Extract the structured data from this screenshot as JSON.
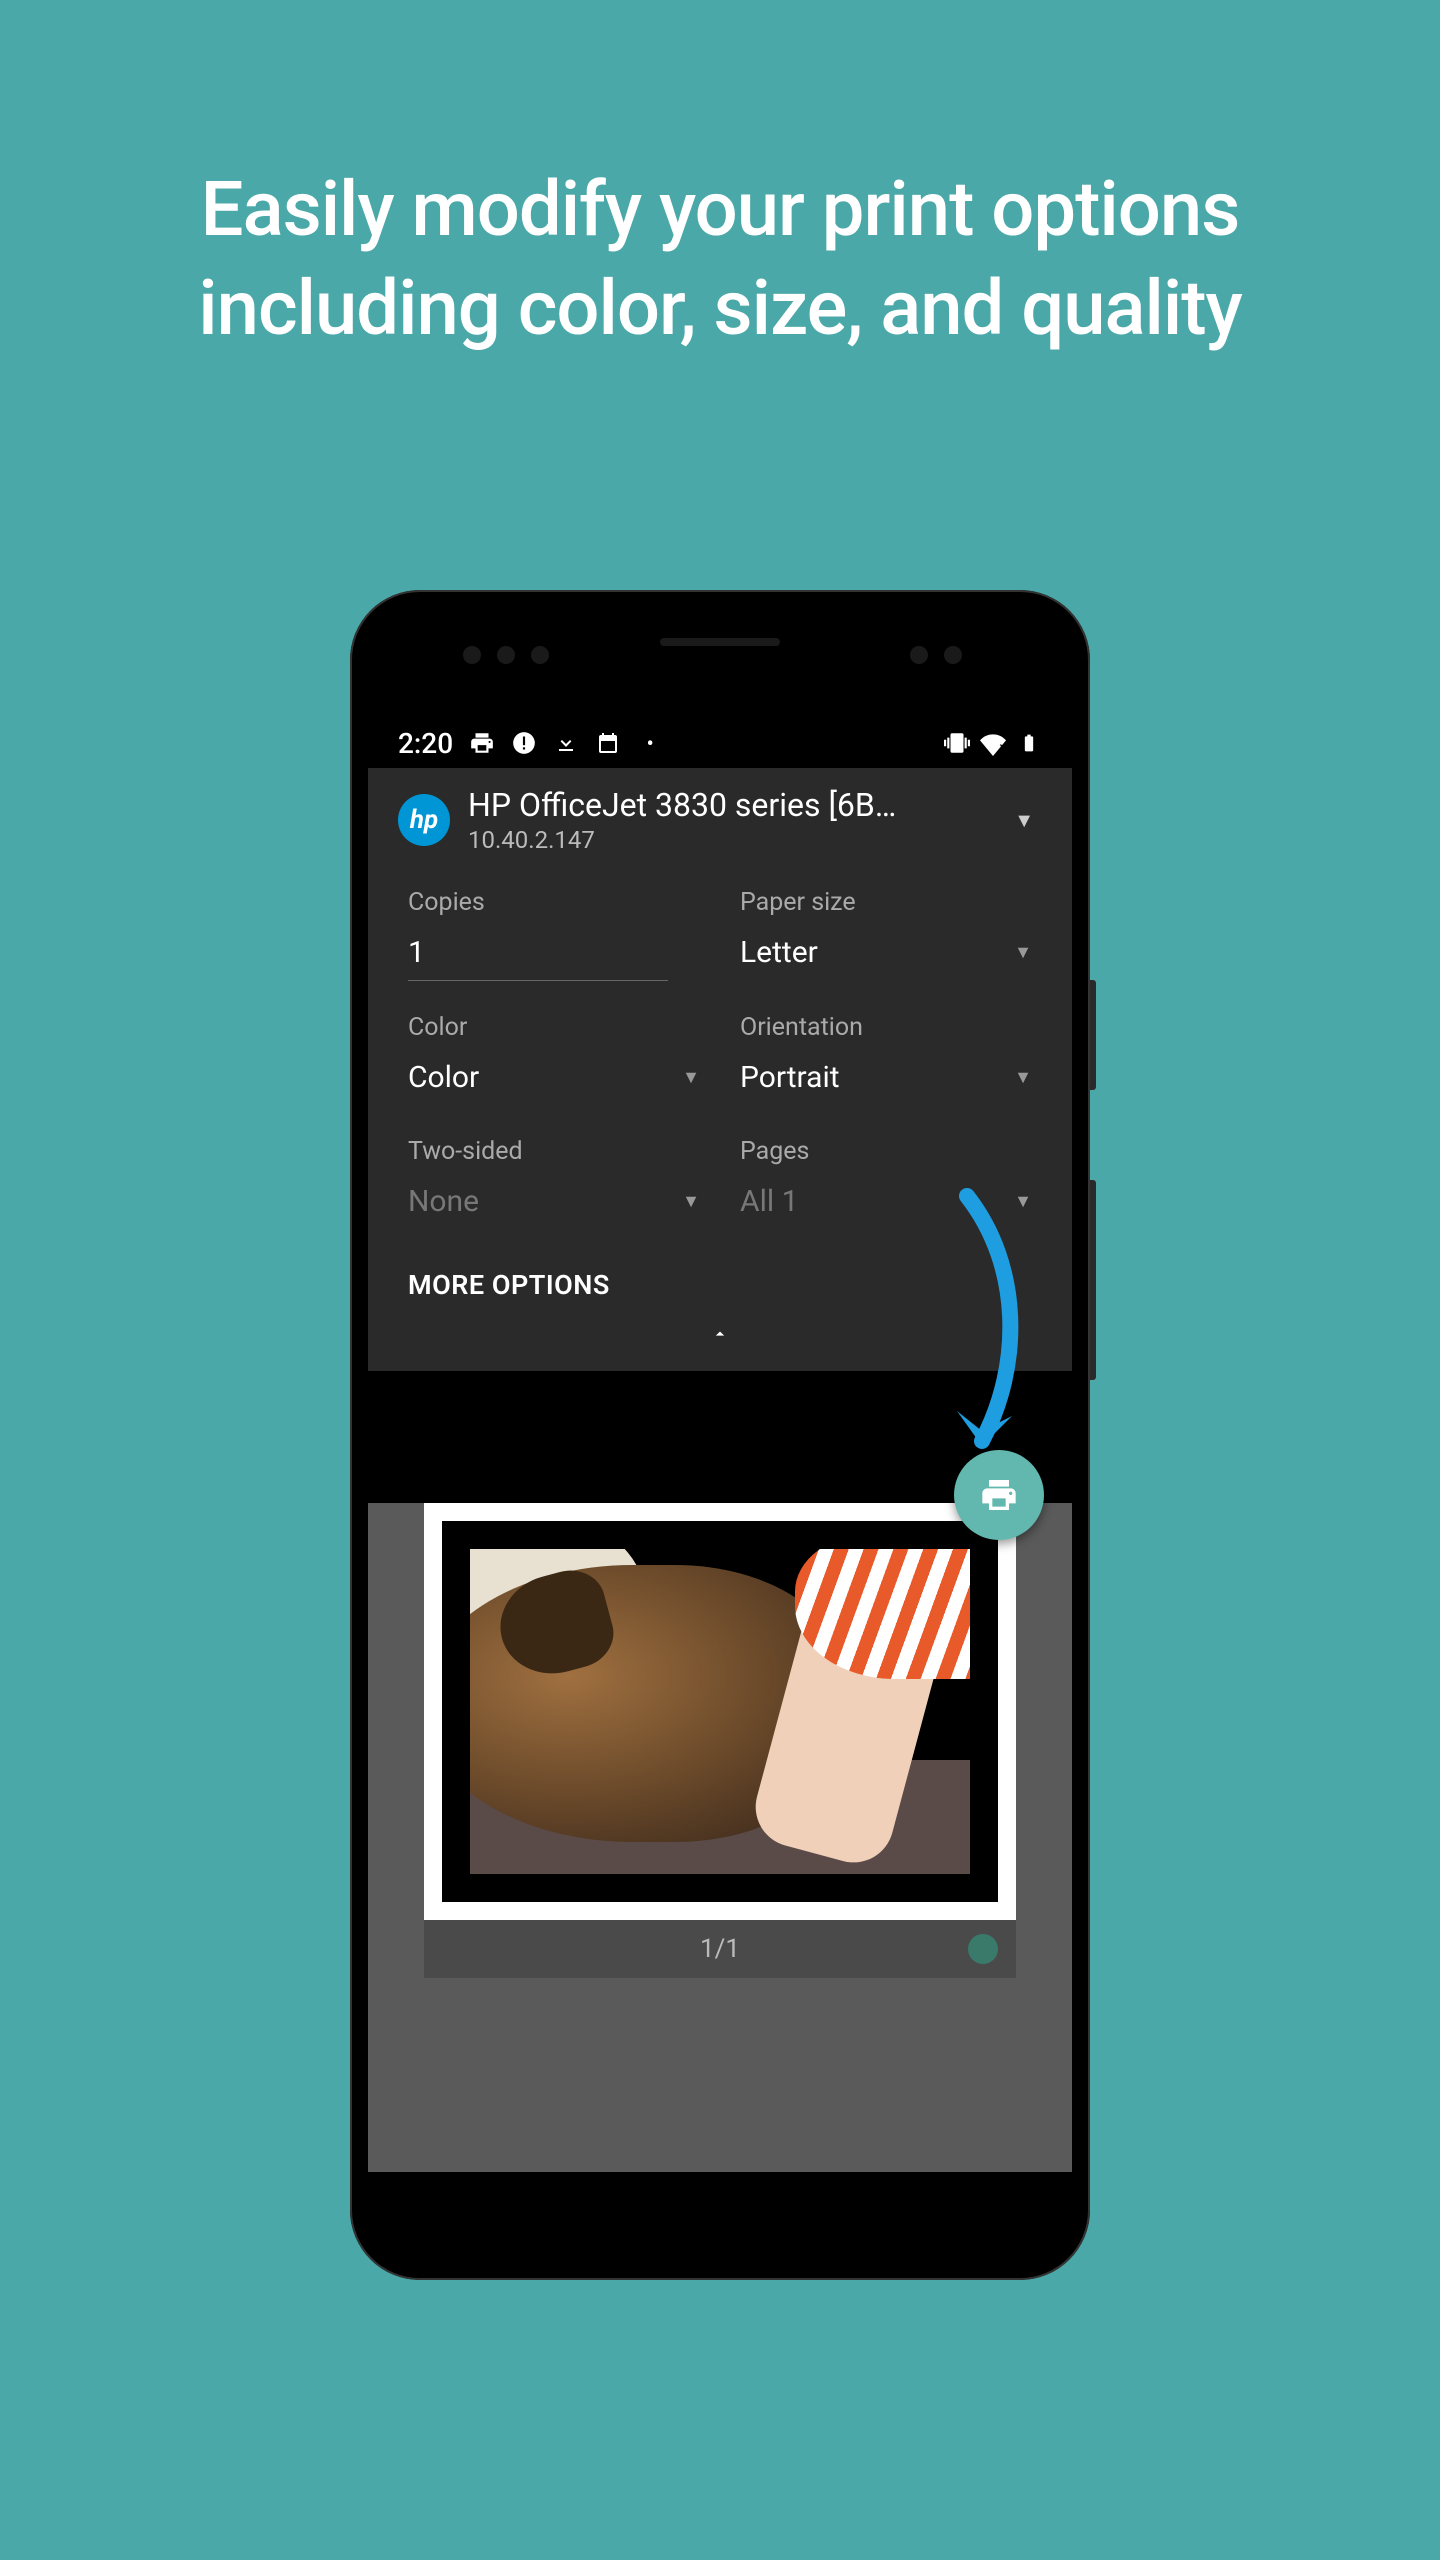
{
  "promo": {
    "headline": "Easily modify your print options including color, size, and quality"
  },
  "status": {
    "time": "2:20"
  },
  "printer": {
    "name": "HP OfficeJet 3830 series [6B…",
    "ip": "10.40.2.147",
    "logo_text": "hp"
  },
  "options": {
    "copies_label": "Copies",
    "copies_value": "1",
    "paper_label": "Paper size",
    "paper_value": "Letter",
    "color_label": "Color",
    "color_value": "Color",
    "orientation_label": "Orientation",
    "orientation_value": "Portrait",
    "twosided_label": "Two-sided",
    "twosided_value": "None",
    "pages_label": "Pages",
    "pages_value": "All 1",
    "more_label": "MORE OPTIONS"
  },
  "preview": {
    "page_counter": "1/1"
  },
  "colors": {
    "accent": "#4ba8a8",
    "fab": "#62b8ae",
    "arrow": "#1e9de0"
  }
}
